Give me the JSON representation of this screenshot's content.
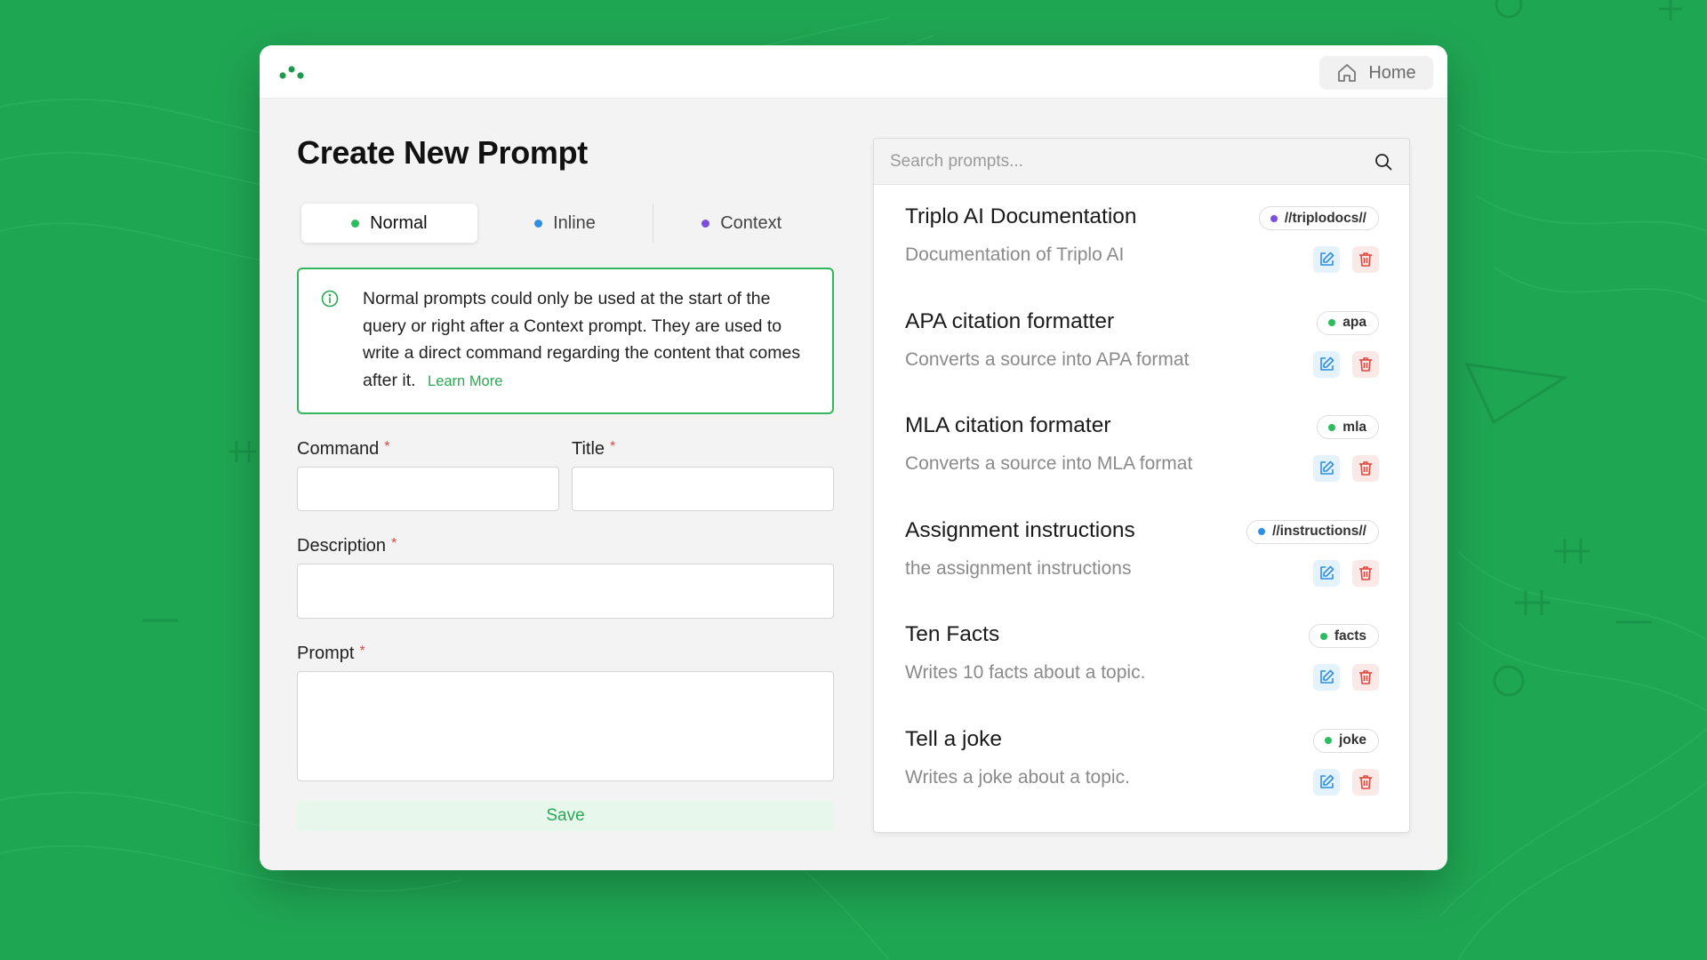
{
  "colors": {
    "background": "#1fa653",
    "accent": "#2aa853",
    "normal_dot": "#2bbd5e",
    "inline_dot": "#2f8fe0",
    "context_dot": "#7a4fe0",
    "required": "#e0483e"
  },
  "header": {
    "logo_icon": "dots-logo-icon",
    "home_label": "Home",
    "home_icon": "home-icon"
  },
  "form": {
    "title": "Create New Prompt",
    "tabs": [
      {
        "label": "Normal",
        "dot_color": "#2bbd5e",
        "active": true
      },
      {
        "label": "Inline",
        "dot_color": "#2f8fe0",
        "active": false
      },
      {
        "label": "Context",
        "dot_color": "#7a4fe0",
        "active": false
      }
    ],
    "info_text": "Normal prompts could only be used at the start of the query or right after a Context prompt. They are used to write a direct command regarding the content that comes after it.",
    "info_link": "Learn More",
    "fields": {
      "command_label": "Command",
      "title_label": "Title",
      "description_label": "Description",
      "prompt_label": "Prompt",
      "required_mark": "*"
    },
    "save_label": "Save"
  },
  "search": {
    "placeholder": "Search prompts...",
    "icon": "search-icon"
  },
  "prompts": [
    {
      "title": "Triplo AI Documentation",
      "description": "Documentation of Triplo AI",
      "tag": "//triplodocs//",
      "tag_color": "#7a4fe0"
    },
    {
      "title": "APA citation formatter",
      "description": "Converts a source into APA format",
      "tag": "apa",
      "tag_color": "#2bbd5e"
    },
    {
      "title": "MLA citation formater",
      "description": "Converts a source into MLA format",
      "tag": "mla",
      "tag_color": "#2bbd5e"
    },
    {
      "title": "Assignment instructions",
      "description": "the assignment instructions",
      "tag": "//instructions//",
      "tag_color": "#2f8fe0"
    },
    {
      "title": "Ten Facts",
      "description": "Writes 10 facts about a topic.",
      "tag": "facts",
      "tag_color": "#2bbd5e"
    },
    {
      "title": "Tell a joke",
      "description": "Writes a joke about a topic.",
      "tag": "joke",
      "tag_color": "#2bbd5e"
    }
  ]
}
